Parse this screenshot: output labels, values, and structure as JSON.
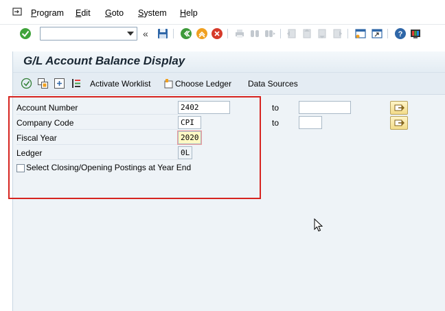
{
  "menu": {
    "items": [
      {
        "first": "P",
        "rest": "rogram"
      },
      {
        "first": "E",
        "rest": "dit"
      },
      {
        "first": "G",
        "rest": "oto"
      },
      {
        "first": "S",
        "rest": "ystem"
      },
      {
        "first": "H",
        "rest": "elp"
      }
    ]
  },
  "toolbar": {
    "command_field_value": "",
    "collapse_glyph": "«"
  },
  "screen": {
    "title": "G/L Account Balance Display",
    "app_toolbar": {
      "activate_worklist": "Activate Worklist",
      "choose_ledger": "Choose Ledger",
      "data_sources": "Data Sources"
    }
  },
  "form": {
    "account_number": {
      "label": "Account Number",
      "value": "2402",
      "to_label": "to",
      "to_value": ""
    },
    "company_code": {
      "label": "Company Code",
      "value": "CPI",
      "to_label": "to",
      "to_value": ""
    },
    "fiscal_year": {
      "label": "Fiscal Year",
      "value": "2020"
    },
    "ledger": {
      "label": "Ledger",
      "value": "0L"
    },
    "closing_postings": {
      "label": "Select Closing/Opening Postings at Year End",
      "checked": false
    }
  },
  "colors": {
    "highlight_box": "#d6231e",
    "focused_field": "#fff9c4",
    "pane_background": "#eef3f7"
  }
}
